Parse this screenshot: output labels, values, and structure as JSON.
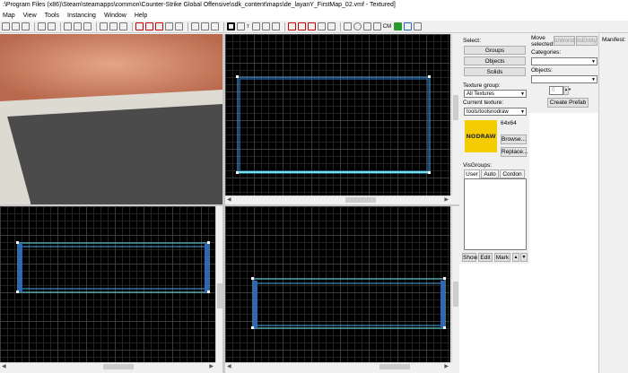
{
  "window": {
    "title": ":\\Program Files (x86)\\Steam\\steamapps\\common\\Counter-Strike Global Offensive\\sdk_content\\maps\\de_layanY_FirstMap_02.vmf - Textured]"
  },
  "menu": [
    "Map",
    "View",
    "Tools",
    "Instancing",
    "Window",
    "Help"
  ],
  "toolbar": {
    "cm_label": "CM",
    "accent_colors": [
      "#cc0000",
      "#1a6ad0",
      "#2a9a2a"
    ]
  },
  "select_panel": {
    "label": "Select:",
    "groups": "Groups",
    "objects": "Objects",
    "solids": "Solids"
  },
  "move_panel": {
    "label": "Move selected:",
    "to_world": "toWorld",
    "to_entity": "toEntity",
    "categories_label": "Categories:",
    "objects_label": "Objects:",
    "spinner_value": "0",
    "create_prefab": "Create Prefab"
  },
  "manifest": {
    "label": "Manifest:"
  },
  "texture": {
    "group_label": "Texture group:",
    "group_value": "All Textures",
    "current_label": "Current texture:",
    "current_value": "tools/toolsnodraw",
    "size": "64x64",
    "preview_text": "NODRAW",
    "preview_color": "#f5cc00",
    "browse": "Browse...",
    "replace": "Replace..."
  },
  "visgroups": {
    "label": "VisGroups:",
    "tabs": [
      "User",
      "Auto",
      "Cordon"
    ],
    "show": "Show",
    "edit": "Edit",
    "mark": "Mark",
    "up_icon": "up-arrow-icon",
    "down_icon": "down-arrow-icon"
  },
  "viewports": {
    "camera": {
      "sky": "#c27a5c",
      "wall": "#d8d4cb",
      "floor": "#4b4b4b"
    },
    "brush_colors": {
      "outline": "#5fc8ff",
      "edge": "#3c6fc0",
      "handle": "#ffffff"
    }
  }
}
